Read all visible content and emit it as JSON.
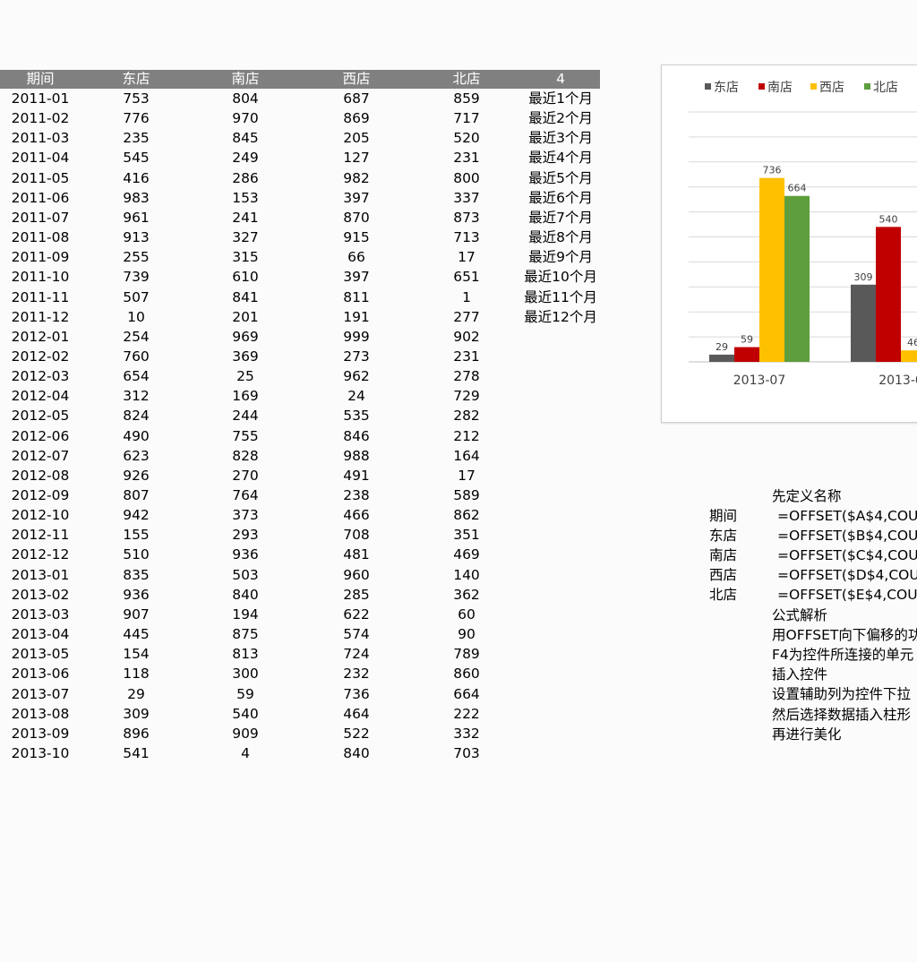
{
  "table": {
    "headers": [
      "期间",
      "东店",
      "南店",
      "西店",
      "北店",
      "4"
    ],
    "rows": [
      [
        "2011-01",
        "753",
        "804",
        "687",
        "859"
      ],
      [
        "2011-02",
        "776",
        "970",
        "869",
        "717"
      ],
      [
        "2011-03",
        "235",
        "845",
        "205",
        "520"
      ],
      [
        "2011-04",
        "545",
        "249",
        "127",
        "231"
      ],
      [
        "2011-05",
        "416",
        "286",
        "982",
        "800"
      ],
      [
        "2011-06",
        "983",
        "153",
        "397",
        "337"
      ],
      [
        "2011-07",
        "961",
        "241",
        "870",
        "873"
      ],
      [
        "2011-08",
        "913",
        "327",
        "915",
        "713"
      ],
      [
        "2011-09",
        "255",
        "315",
        "66",
        "17"
      ],
      [
        "2011-10",
        "739",
        "610",
        "397",
        "651"
      ],
      [
        "2011-11",
        "507",
        "841",
        "811",
        "1"
      ],
      [
        "2011-12",
        "10",
        "201",
        "191",
        "277"
      ],
      [
        "2012-01",
        "254",
        "969",
        "999",
        "902"
      ],
      [
        "2012-02",
        "760",
        "369",
        "273",
        "231"
      ],
      [
        "2012-03",
        "654",
        "25",
        "962",
        "278"
      ],
      [
        "2012-04",
        "312",
        "169",
        "24",
        "729"
      ],
      [
        "2012-05",
        "824",
        "244",
        "535",
        "282"
      ],
      [
        "2012-06",
        "490",
        "755",
        "846",
        "212"
      ],
      [
        "2012-07",
        "623",
        "828",
        "988",
        "164"
      ],
      [
        "2012-08",
        "926",
        "270",
        "491",
        "17"
      ],
      [
        "2012-09",
        "807",
        "764",
        "238",
        "589"
      ],
      [
        "2012-10",
        "942",
        "373",
        "466",
        "862"
      ],
      [
        "2012-11",
        "155",
        "293",
        "708",
        "351"
      ],
      [
        "2012-12",
        "510",
        "936",
        "481",
        "469"
      ],
      [
        "2013-01",
        "835",
        "503",
        "960",
        "140"
      ],
      [
        "2013-02",
        "936",
        "840",
        "285",
        "362"
      ],
      [
        "2013-03",
        "907",
        "194",
        "622",
        "60"
      ],
      [
        "2013-04",
        "445",
        "875",
        "574",
        "90"
      ],
      [
        "2013-05",
        "154",
        "813",
        "724",
        "789"
      ],
      [
        "2013-06",
        "118",
        "300",
        "232",
        "860"
      ],
      [
        "2013-07",
        "29",
        "59",
        "736",
        "664"
      ],
      [
        "2013-08",
        "309",
        "540",
        "464",
        "222"
      ],
      [
        "2013-09",
        "896",
        "909",
        "522",
        "332"
      ],
      [
        "2013-10",
        "541",
        "4",
        "840",
        "703"
      ]
    ],
    "helper": [
      "最近1个月",
      "最近2个月",
      "最近3个月",
      "最近4个月",
      "最近5个月",
      "最近6个月",
      "最近7个月",
      "最近8个月",
      "最近9个月",
      "最近10个月",
      "最近11个月",
      "最近12个月"
    ]
  },
  "chart_data": {
    "type": "bar",
    "categories": [
      "2013-07",
      "2013-0"
    ],
    "series": [
      {
        "name": "东店",
        "values": [
          29,
          309
        ]
      },
      {
        "name": "南店",
        "values": [
          59,
          540
        ]
      },
      {
        "name": "西店",
        "values": [
          736,
          46
        ]
      },
      {
        "name": "北店",
        "values": [
          664,
          null
        ]
      }
    ],
    "data_labels": [
      [
        "29",
        "309"
      ],
      [
        "59",
        "540"
      ],
      [
        "736",
        "46"
      ],
      [
        "664",
        ""
      ]
    ],
    "colors": {
      "东店": "#595959",
      "南店": "#c00000",
      "西店": "#ffc000",
      "北店": "#5e9e3c"
    },
    "ylim": [
      0,
      1000
    ],
    "grid": true,
    "legend": "top"
  },
  "notes": {
    "title": "先定义名称",
    "names": [
      {
        "label": "期间",
        "formula": "=OFFSET($A$4,COUN"
      },
      {
        "label": "东店",
        "formula": "=OFFSET($B$4,COUN"
      },
      {
        "label": "南店",
        "formula": "=OFFSET($C$4,COU"
      },
      {
        "label": "西店",
        "formula": "=OFFSET($D$4,COU"
      },
      {
        "label": "北店",
        "formula": "=OFFSET($E$4,COUN"
      }
    ],
    "lines": [
      "公式解析",
      "用OFFSET向下偏移的功",
      "F4为控件所连接的单元",
      "插入控件",
      "设置辅助列为控件下拉",
      "然后选择数据插入柱形",
      "再进行美化"
    ]
  }
}
